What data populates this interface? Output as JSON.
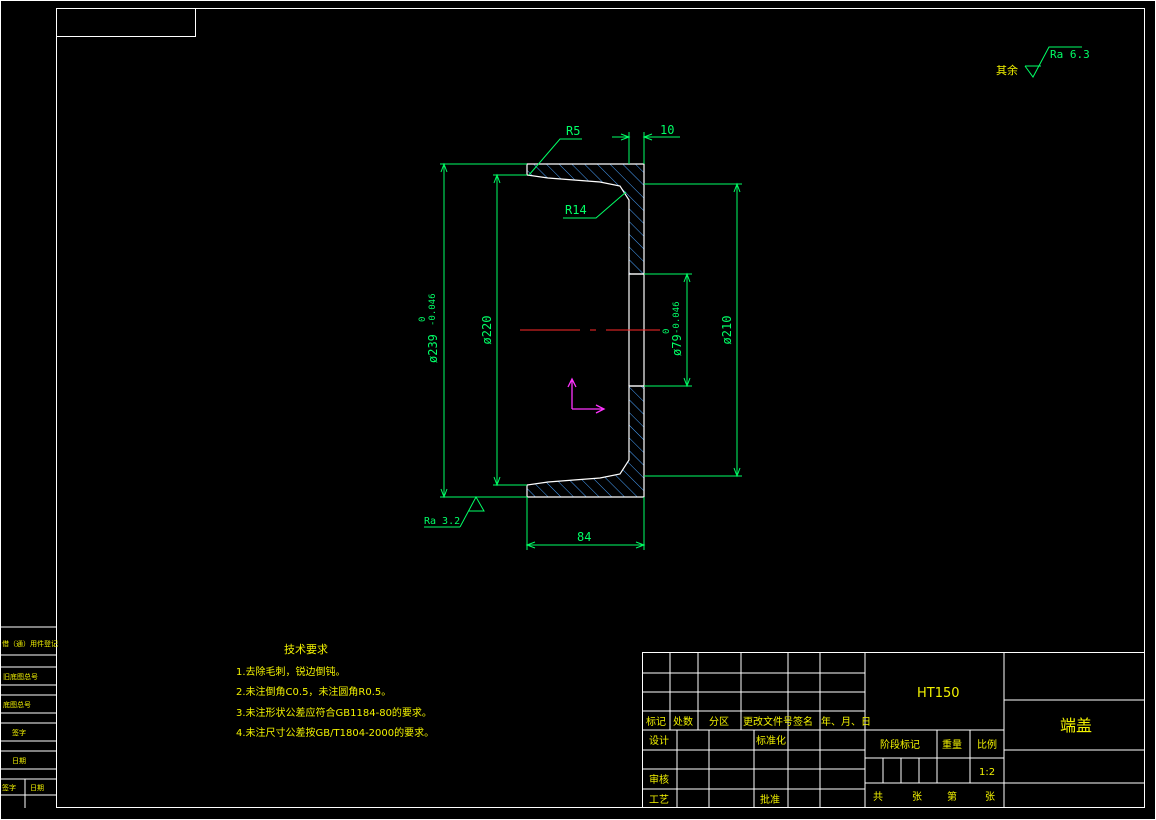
{
  "colors": {
    "background": "#000000",
    "frame": "#ffffff",
    "outline": "#ffffff",
    "dimension": "#00ff66",
    "hatch": "#4aa3ff",
    "text": "#f2f200",
    "centerline": "#ff2a2a",
    "ucs": "#ff33ff"
  },
  "roughness": {
    "other_label": "其余",
    "other_value": "Ra 6.3",
    "face_value": "Ra 3.2"
  },
  "dimensions": {
    "r5": "R5",
    "r14": "R14",
    "thickness": "10",
    "od_main": "ø239",
    "od_tol_upper": "0",
    "od_tol_lower": "-0.046",
    "id_220": "ø220",
    "bore_79": "ø79",
    "bore_tol_upper": "0",
    "bore_tol_lower": "-0.046",
    "od_210": "ø210",
    "length_84": "84"
  },
  "technical_requirements": {
    "title": "技术要求",
    "items": [
      "1.去除毛刺，锐边倒钝。",
      "2.未注倒角C0.5，未注圆角R0.5。",
      "3.未注形状公差应符合GB1184-80的要求。",
      "4.未注尺寸公差按GB/T1804-2000的要求。"
    ]
  },
  "side_table": {
    "rows": [
      "借（通）用件登记",
      "旧底图总号",
      "底图总号",
      "签字",
      "日期"
    ],
    "bottom": [
      "签字",
      "日期"
    ]
  },
  "title_block": {
    "material": "HT150",
    "part_name": "端盖",
    "header": [
      "标记",
      "处数",
      "分区",
      "更改文件号",
      "签名",
      "年、月、日"
    ],
    "design": "设计",
    "standardization": "标准化",
    "review": "审核",
    "process": "工艺",
    "approve": "批准",
    "stage_mark": "阶段标记",
    "weight": "重量",
    "scale_label": "比例",
    "scale_value": "1:2",
    "total_label": "共",
    "sheet_unit": "张",
    "sheet_label": "第",
    "sheet_unit2": "张"
  }
}
